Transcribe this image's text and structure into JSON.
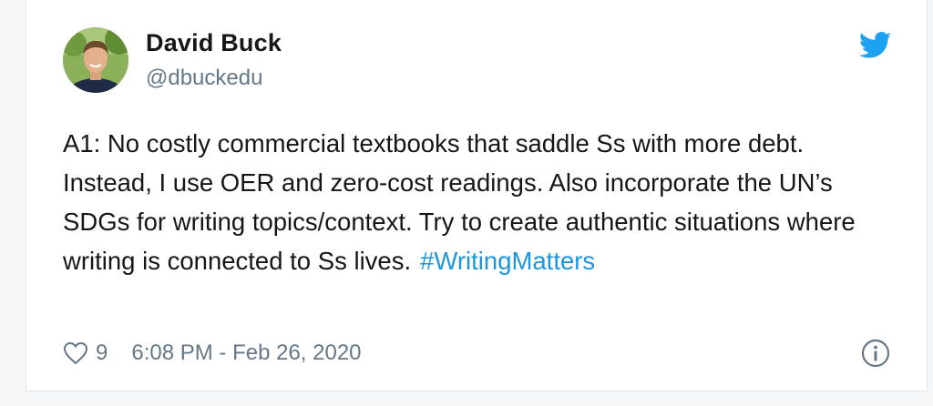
{
  "tweet": {
    "author_name": "David Buck",
    "author_handle": "@dbuckedu",
    "text": "A1: No costly commercial textbooks that saddle Ss with more debt. Instead, I use OER and zero-cost readings. Also incorporate the UN’s SDGs for writing topics/context. Try to create authentic situations where writing is connected to Ss lives.",
    "hashtag": "#WritingMatters",
    "like_count": "9",
    "timestamp": "6:08 PM - Feb 26, 2020"
  },
  "icons": {
    "brand": "twitter-bird-icon",
    "like": "heart-icon",
    "info": "info-icon"
  },
  "colors": {
    "brand_blue": "#1da1f2",
    "link_blue": "#1b95e0",
    "secondary_text": "#657786",
    "primary_text": "#14171a"
  }
}
